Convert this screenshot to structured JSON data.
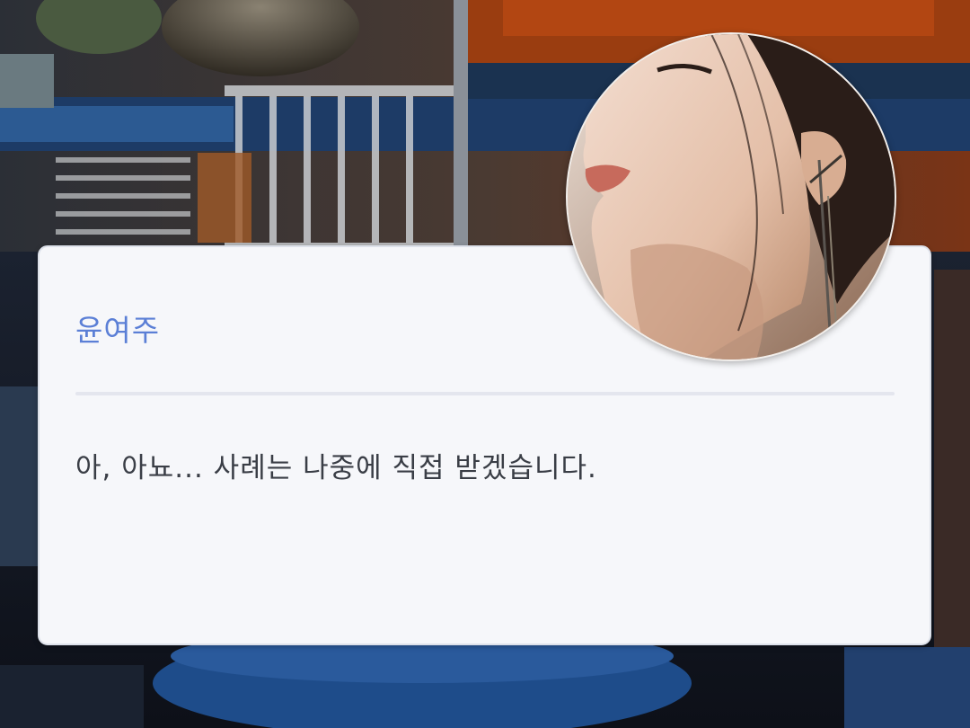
{
  "dialog": {
    "speaker": "윤여주",
    "text": "아, 아뇨... 사례는 나중에 직접 받겠습니다."
  },
  "colors": {
    "speaker_name": "#5b7fd6",
    "dialogue_text": "#3a3e46",
    "dialog_background": "#f6f7fa"
  }
}
